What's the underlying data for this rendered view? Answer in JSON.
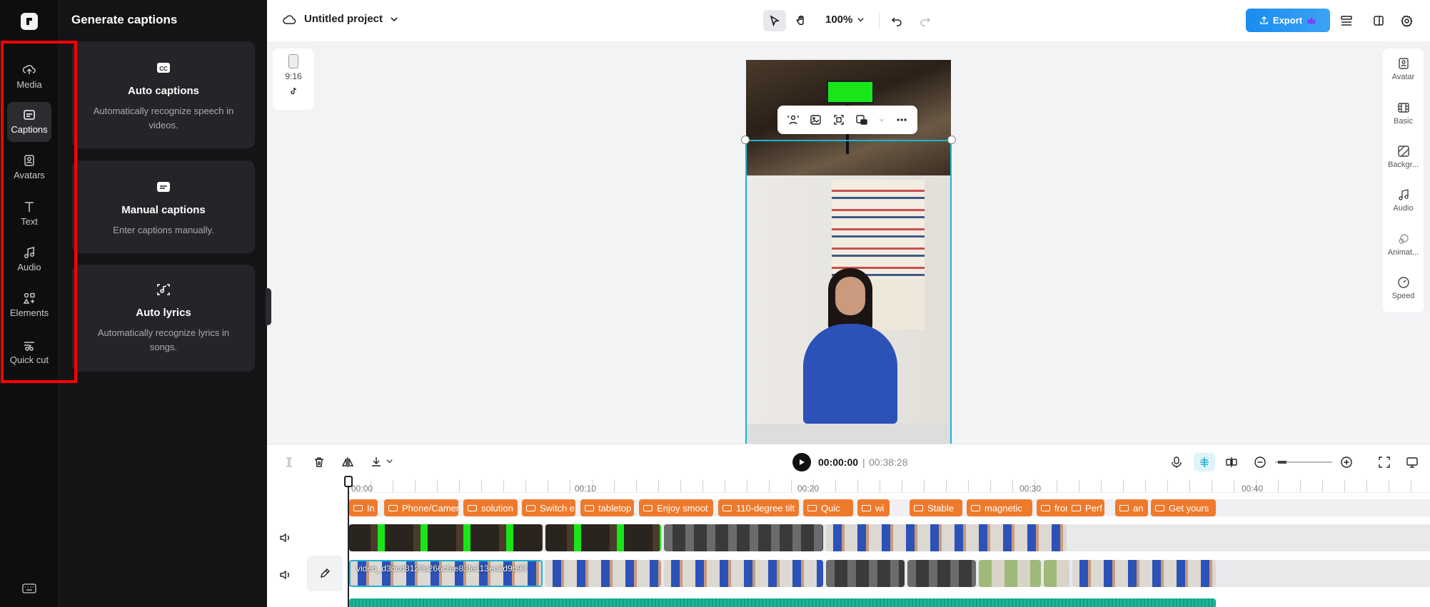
{
  "rail": {
    "items": [
      {
        "id": "media",
        "label": "Media",
        "icon": "cloud-upload-icon"
      },
      {
        "id": "captions",
        "label": "Captions",
        "icon": "captions-icon",
        "active": true
      },
      {
        "id": "avatars",
        "label": "Avatars",
        "icon": "avatar-icon"
      },
      {
        "id": "text",
        "label": "Text",
        "icon": "text-icon"
      },
      {
        "id": "audio",
        "label": "Audio",
        "icon": "music-note-icon"
      },
      {
        "id": "elements",
        "label": "Elements",
        "icon": "elements-icon"
      },
      {
        "id": "quickcut",
        "label": "Quick cut",
        "icon": "scissors-icon"
      }
    ]
  },
  "panel": {
    "title": "Generate captions",
    "cards": [
      {
        "title": "Auto captions",
        "desc": "Automatically recognize speech in videos.",
        "icon": "cc-icon"
      },
      {
        "title": "Manual captions",
        "desc": "Enter captions manually.",
        "icon": "subtitles-icon"
      },
      {
        "title": "Auto lyrics",
        "desc": "Automatically recognize lyrics in songs.",
        "icon": "lyrics-scan-icon"
      }
    ]
  },
  "topbar": {
    "project_name": "Untitled project",
    "zoom": "100%",
    "export_label": "Export"
  },
  "canvas": {
    "aspect_ratio": "9:16"
  },
  "inspector": {
    "items": [
      {
        "label": "Avatar",
        "icon": "avatar-icon"
      },
      {
        "label": "Basic",
        "icon": "film-icon"
      },
      {
        "label": "Backgr...",
        "icon": "background-icon"
      },
      {
        "label": "Audio",
        "icon": "music-note-icon"
      },
      {
        "label": "Animat...",
        "icon": "animation-icon"
      },
      {
        "label": "Speed",
        "icon": "speed-icon"
      }
    ]
  },
  "timeline": {
    "current_time": "00:00:00",
    "separator": "|",
    "total_time": "00:38:28",
    "ruler": [
      "00:00",
      "00:10",
      "00:20",
      "00:30",
      "00:40"
    ],
    "caption_clips": [
      "In",
      "Phone/Camera/Po",
      "solution",
      "Switch e",
      "tabletop",
      "Enjoy smoot",
      "110-degree tilt",
      "Quic",
      "wi",
      "Stable",
      "magnetic",
      "fron",
      "Perf",
      "an",
      "Get yours"
    ],
    "selected_clip_label": "video_d3dcd8120c266cfee83fe113ec2d9b93"
  },
  "colors": {
    "accent": "#1cb4d4",
    "caption_clip": "#ef7a2c",
    "export": "#1a8cf0",
    "highlight": "#ff0000"
  }
}
